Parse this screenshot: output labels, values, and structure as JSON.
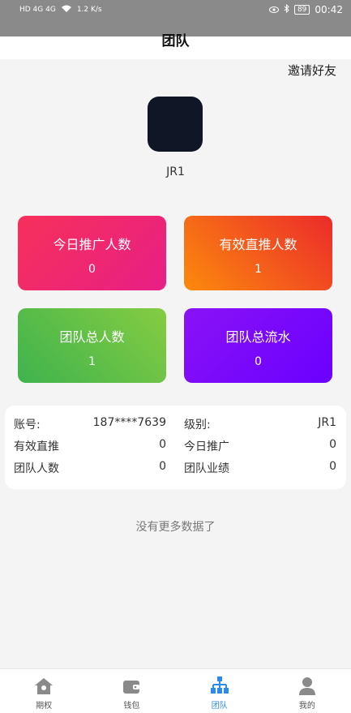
{
  "status": {
    "network": "HD 4G 4G",
    "speed": "1.2 K/s",
    "battery": "89",
    "time": "00:42"
  },
  "header": {
    "title": "团队",
    "invite": "邀请好友"
  },
  "profile": {
    "name": "JR1"
  },
  "stats": [
    {
      "label": "今日推广人数",
      "value": "0"
    },
    {
      "label": "有效直推人数",
      "value": "1"
    },
    {
      "label": "团队总人数",
      "value": "1"
    },
    {
      "label": "团队总流水",
      "value": "0"
    }
  ],
  "info": {
    "account_label": "账号:",
    "account_value": "187****7639",
    "level_label": "级别:",
    "level_value": "JR1",
    "direct_label": "有效直推",
    "direct_value": "0",
    "today_label": "今日推广",
    "today_value": "0",
    "team_count_label": "团队人数",
    "team_count_value": "0",
    "team_perf_label": "团队业绩",
    "team_perf_value": "0"
  },
  "list": {
    "no_more": "没有更多数据了"
  },
  "tabs": [
    {
      "label": "期权",
      "icon": "home-icon"
    },
    {
      "label": "钱包",
      "icon": "wallet-icon"
    },
    {
      "label": "团队",
      "icon": "team-icon",
      "active": true
    },
    {
      "label": "我的",
      "icon": "user-icon"
    }
  ],
  "colors": {
    "accent": "#2d8be8"
  }
}
